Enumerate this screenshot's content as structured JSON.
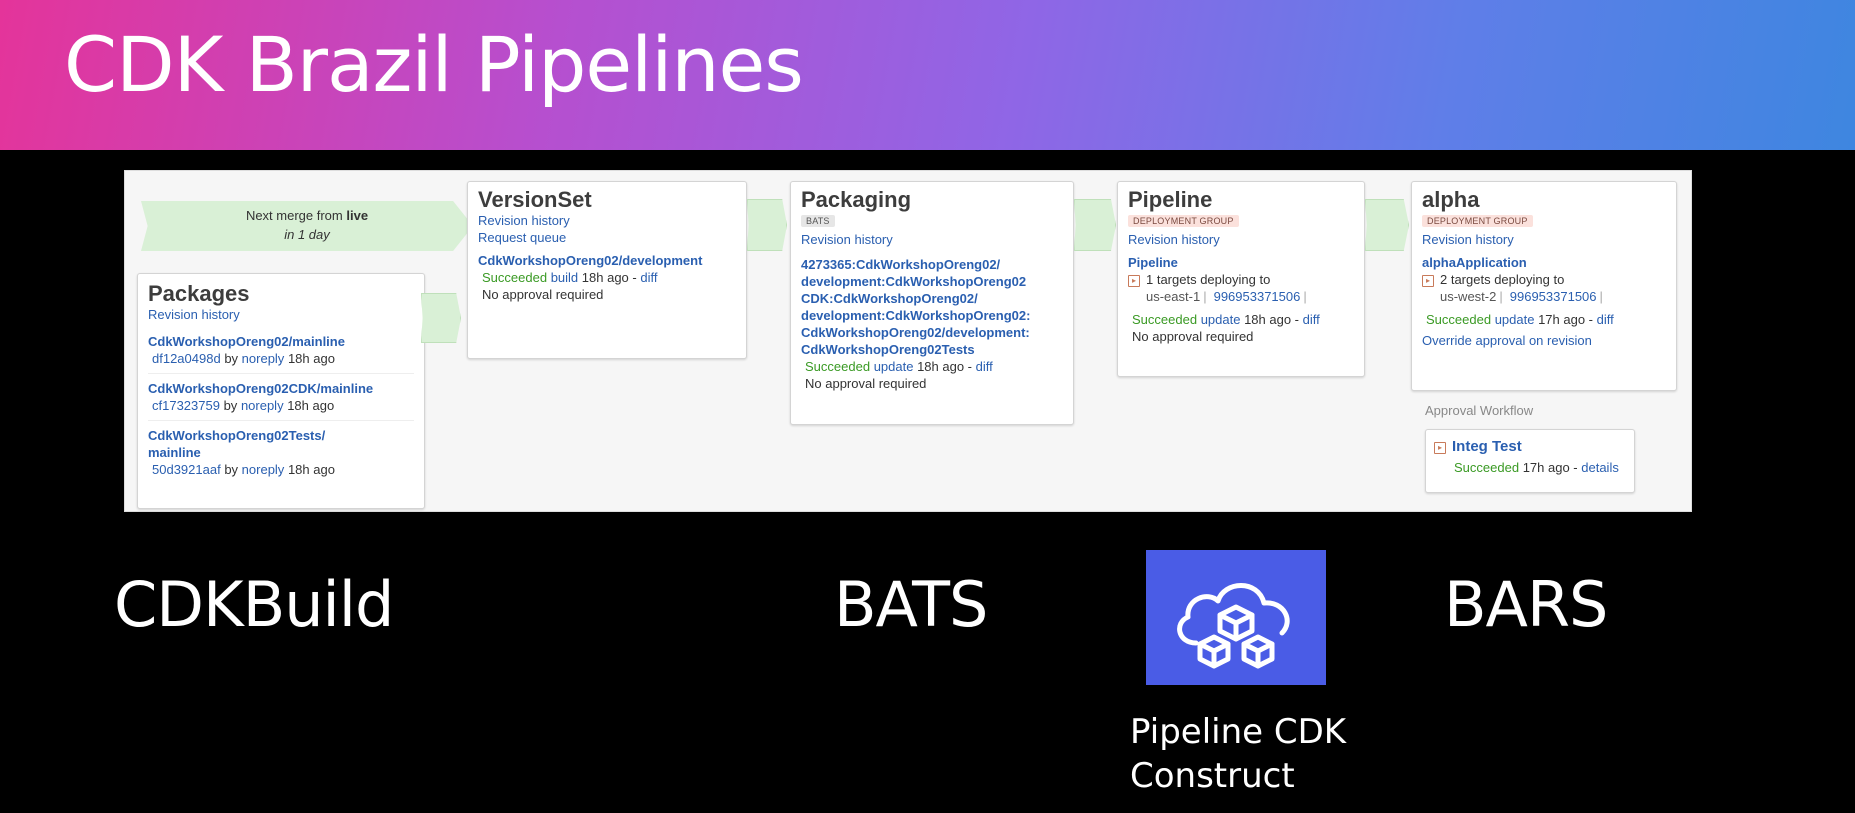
{
  "slide": {
    "title": "CDK Brazil Pipelines"
  },
  "merge": {
    "line1_prefix": "Next merge from ",
    "line1_bold": "live",
    "line2": "in 1 day"
  },
  "packages": {
    "title": "Packages",
    "revision_history": "Revision history",
    "items": [
      {
        "name": "CdkWorkshopOreng02/mainline",
        "hash": "df12a0498d",
        "by": "by",
        "user": "noreply",
        "ago": "18h ago"
      },
      {
        "name": "CdkWorkshopOreng02CDK/mainline",
        "hash": "cf17323759",
        "by": "by",
        "user": "noreply",
        "ago": "18h ago"
      },
      {
        "name": "CdkWorkshopOreng02Tests/\nmainline",
        "hash": "50d3921aaf",
        "by": "by",
        "user": "noreply",
        "ago": "18h ago"
      }
    ]
  },
  "versionset": {
    "title": "VersionSet",
    "revision_history": "Revision history",
    "request_queue": "Request queue",
    "link": "CdkWorkshopOreng02/development",
    "status": "Succeeded",
    "action": "build",
    "ago": "18h ago -",
    "diff": "diff",
    "approval": "No approval required"
  },
  "packaging": {
    "title": "Packaging",
    "tag": "BATS",
    "revision_history": "Revision history",
    "lines": [
      "4273365:CdkWorkshopOreng02/",
      "development:CdkWorkshopOreng02",
      "CDK:CdkWorkshopOreng02/",
      "development:CdkWorkshopOreng02:",
      "CdkWorkshopOreng02/development:",
      "CdkWorkshopOreng02Tests"
    ],
    "status": "Succeeded",
    "action": "update",
    "ago": "18h ago -",
    "diff": "diff",
    "approval": "No approval required"
  },
  "pipeline": {
    "title": "Pipeline",
    "tag": "DEPLOYMENT GROUP",
    "revision_history": "Revision history",
    "app": "Pipeline",
    "targets": "1 targets deploying to",
    "region": "us-east-1",
    "account": "996953371506",
    "status": "Succeeded",
    "action": "update",
    "ago": "18h ago -",
    "diff": "diff",
    "approval": "No approval required"
  },
  "alpha": {
    "title": "alpha",
    "tag": "DEPLOYMENT GROUP",
    "revision_history": "Revision history",
    "app": "alphaApplication",
    "targets": "2 targets deploying to",
    "region": "us-west-2",
    "account": "996953371506",
    "status": "Succeeded",
    "action": "update",
    "ago": "17h ago -",
    "diff": "diff",
    "override": "Override approval on revision",
    "approval_workflow": "Approval Workflow",
    "integ_title": "Integ Test",
    "integ_status": "Succeeded",
    "integ_ago": "17h ago -",
    "integ_details": "details"
  },
  "labels": {
    "cdkbuild": "CDKBuild",
    "bats": "BATS",
    "bars": "BARS",
    "construct_line1": "Pipeline CDK",
    "construct_line2": "Construct"
  },
  "icons": {
    "construct": "cloud-cubes-icon",
    "deploy": "deploy-arrow-icon"
  },
  "colors": {
    "link": "#2a5fb0",
    "success": "#3a9a24",
    "construct_bg": "#4a5ce6"
  }
}
